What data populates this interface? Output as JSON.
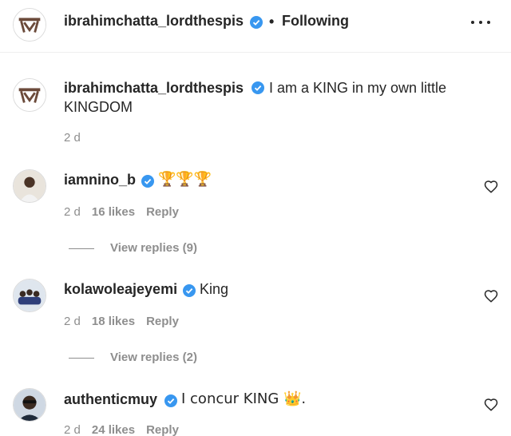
{
  "header": {
    "username": "ibrahimchatta_lordthespis",
    "separator": "•",
    "follow_status": "Following",
    "more_icon": "more-horizontal-icon"
  },
  "caption": {
    "username": "ibrahimchatta_lordthespis",
    "text_line1": "I am a KING in my own little",
    "text_line2": "KINGDOM",
    "time": "2 d"
  },
  "comments": [
    {
      "username": "iamnino_b",
      "text": "🏆🏆🏆",
      "time": "2 d",
      "likes": "16 likes",
      "reply": "Reply",
      "view_replies": "View replies (9)"
    },
    {
      "username": "kolawoleajeyemi",
      "text": "King",
      "time": "2 d",
      "likes": "18 likes",
      "reply": "Reply",
      "view_replies": "View replies (2)"
    },
    {
      "username": "authenticmuy",
      "text": "I concur KING 👑.",
      "time": "2 d",
      "likes": "24 likes",
      "reply": "Reply"
    }
  ],
  "colors": {
    "verified": "#3897f0",
    "muted": "#8e8e8e",
    "text": "#262626"
  }
}
